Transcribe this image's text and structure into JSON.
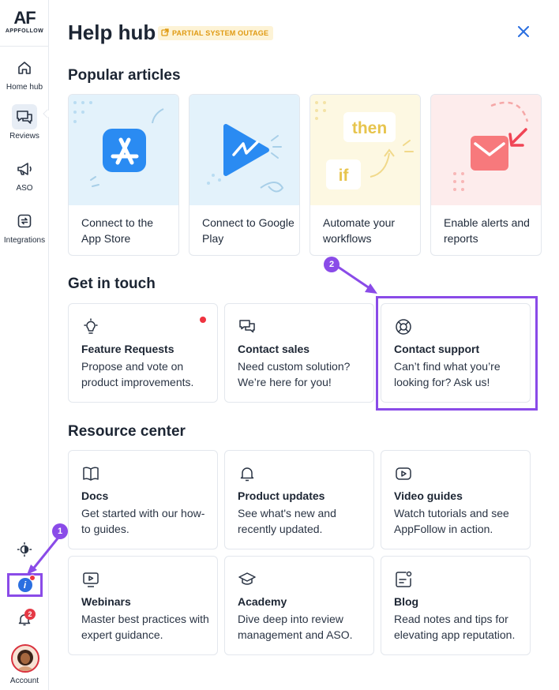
{
  "sidebar": {
    "logo_mark": "AF",
    "logo_sub": "APPFOLLOW",
    "items": [
      {
        "label": "Home hub",
        "icon": "home-icon"
      },
      {
        "label": "Reviews",
        "icon": "reviews-icon",
        "active": true
      },
      {
        "label": "ASO",
        "icon": "megaphone-icon"
      },
      {
        "label": "Integrations",
        "icon": "integrations-icon"
      }
    ],
    "bottom": {
      "theme_icon": "theme-toggle-icon",
      "help_icon": "help-hub-icon",
      "notification_count": "2",
      "account_label": "Account"
    }
  },
  "callouts": {
    "first": "1",
    "second": "2"
  },
  "header": {
    "title": "Help hub",
    "status_badge": "PARTIAL SYSTEM OUTAGE",
    "close_icon": "close-icon"
  },
  "popular": {
    "title": "Popular articles",
    "articles": [
      {
        "text": "Connect to the App Store",
        "art": "app-store-icon"
      },
      {
        "text": "Connect to Google Play",
        "art": "google-play-icon"
      },
      {
        "text": "Automate your workflows",
        "art": "if-then-icon",
        "art_text_1": "then",
        "art_text_2": "if"
      },
      {
        "text": "Enable alerts and reports",
        "art": "mail-icon"
      }
    ]
  },
  "contact": {
    "title": "Get in touch",
    "cards": [
      {
        "title": "Feature Requests",
        "desc": "Propose and vote on product improvements.",
        "icon": "lightbulb-icon"
      },
      {
        "title": "Contact sales",
        "desc": "Need custom solution? We’re here for you!",
        "icon": "chat-bubbles-icon"
      },
      {
        "title": "Contact support",
        "desc": "Can’t find what you’re looking for? Ask us!",
        "icon": "lifebuoy-icon"
      }
    ]
  },
  "resources": {
    "title": "Resource center",
    "cards": [
      {
        "title": "Docs",
        "desc": "Get started with our how-to guides.",
        "icon": "book-icon"
      },
      {
        "title": "Product updates",
        "desc": "See what's new and recently updated.",
        "icon": "bell-icon"
      },
      {
        "title": "Video guides",
        "desc": "Watch tutorials and see AppFollow in action.",
        "icon": "play-icon"
      },
      {
        "title": "Webinars",
        "desc": "Master best practices with expert guidance.",
        "icon": "monitor-play-icon"
      },
      {
        "title": "Academy",
        "desc": "Dive deep into review management and ASO.",
        "icon": "graduation-cap-icon"
      },
      {
        "title": "Blog",
        "desc": "Read notes and tips for elevating app reputation.",
        "icon": "blog-note-icon"
      }
    ]
  },
  "colors": {
    "accent": "#8a4be8",
    "brand_blue": "#2b6fe0",
    "warning": "#e09a12",
    "alert_red": "#ef3340"
  }
}
